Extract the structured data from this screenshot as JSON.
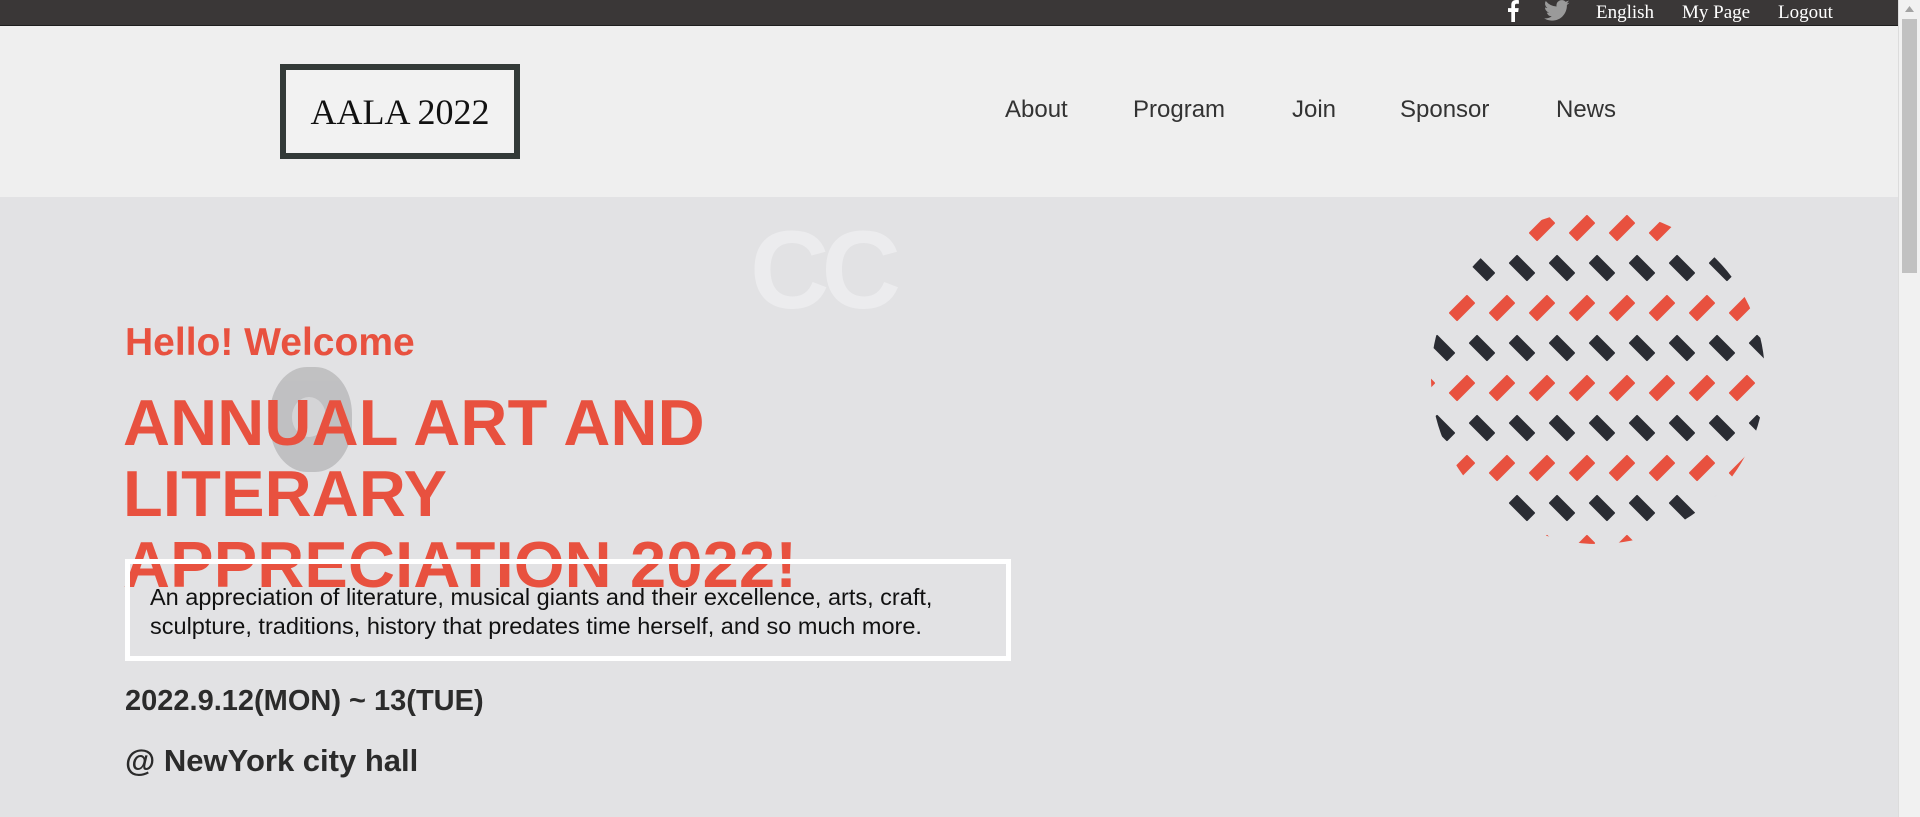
{
  "topbar": {
    "facebook_icon": "facebook-icon",
    "twitter_icon": "twitter-icon",
    "links": [
      "English",
      "My Page",
      "Logout"
    ]
  },
  "header": {
    "logo": "AALA 2022",
    "nav": [
      "About",
      "Program",
      "Join",
      "Sponsor",
      "News"
    ]
  },
  "hero": {
    "greeting": "Hello! Welcome",
    "headline_line1": "ANNUAL ART AND LITERARY",
    "headline_line2": "APPRECIATION 2022!",
    "description": "An appreciation of literature, musical giants and their excellence, arts, craft, sculpture, traditions, history that predates time herself, and so much more.",
    "dates": "2022.9.12(MON) ~ 13(TUE)",
    "venue": "@ NewYork city hall"
  },
  "colors": {
    "accent": "#e8513f",
    "topbar": "#3a3737",
    "header_bg": "#efefef",
    "hero_bg": "#e2e2e4",
    "pattern_dark": "#2a2c33"
  }
}
